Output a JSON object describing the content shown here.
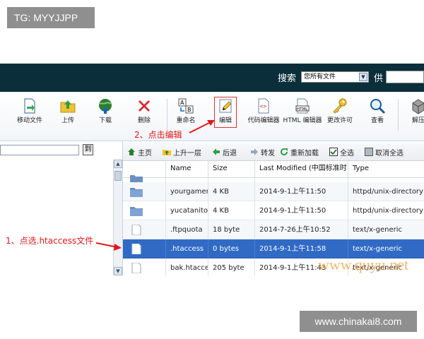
{
  "overlay": {
    "tg_label": "TG: MYYJJPP",
    "site_label": "www.chinakai8.com",
    "watermark": "www.quyu.net",
    "step1": "1、点选.htaccess文件",
    "step2": "2、点击编辑",
    "annotation_color": "#e01818"
  },
  "topbar": {
    "search_label": "搜索",
    "scope_value": "您所有文件",
    "provide_label": "供",
    "background": "#0b2e3b"
  },
  "toolbar": {
    "buttons": [
      {
        "label": "移动文件",
        "icon": "move-file-icon"
      },
      {
        "label": "上传",
        "icon": "upload-icon"
      },
      {
        "label": "下载",
        "icon": "download-icon"
      },
      {
        "label": "删除",
        "icon": "delete-icon"
      },
      {
        "label": "重命名",
        "icon": "rename-icon"
      },
      {
        "label": "编辑",
        "icon": "edit-icon"
      },
      {
        "label": "代码编辑器",
        "icon": "code-editor-icon"
      },
      {
        "label": "HTML 编辑器",
        "icon": "html-editor-icon"
      },
      {
        "label": "更改许可",
        "icon": "permissions-key-icon"
      },
      {
        "label": "查看",
        "icon": "view-magnifier-icon"
      },
      {
        "label": "解压",
        "icon": "extract-icon"
      }
    ]
  },
  "leftpane": {
    "go_label": "到"
  },
  "navbar": {
    "items": [
      "主页",
      "上升一层",
      "后退",
      "转发",
      "重新加载",
      "全选",
      "取消全选"
    ]
  },
  "table": {
    "columns": [
      "",
      "Name",
      "Size",
      "Last Modified (中国标准时",
      "Type"
    ],
    "rows": [
      {
        "icon": "folder-icon",
        "name": "",
        "size": "",
        "modified": "",
        "type": ""
      },
      {
        "icon": "folder-icon",
        "name": "yourgamere",
        "size": "4 KB",
        "modified": "2014-9-1上午11:50",
        "type": "httpd/unix-directory"
      },
      {
        "icon": "folder-icon",
        "name": "yucatanitoc",
        "size": "4 KB",
        "modified": "2014-9-1上午11:50",
        "type": "httpd/unix-directory"
      },
      {
        "icon": "file-icon",
        "name": ".ftpquota",
        "size": "18 byte",
        "modified": "2014-7-26上午10:52",
        "type": "text/x-generic"
      },
      {
        "icon": "file-icon",
        "name": ".htaccess",
        "size": "0 bytes",
        "modified": "2014-9-1上午11:58",
        "type": "text/x-generic",
        "selected": true
      },
      {
        "icon": "file-icon",
        "name": "bak.htacce",
        "size": "205 byte",
        "modified": "2014-9-1上午11:43",
        "type": "text/x-generic"
      }
    ],
    "selected_color": "#316ac5"
  }
}
